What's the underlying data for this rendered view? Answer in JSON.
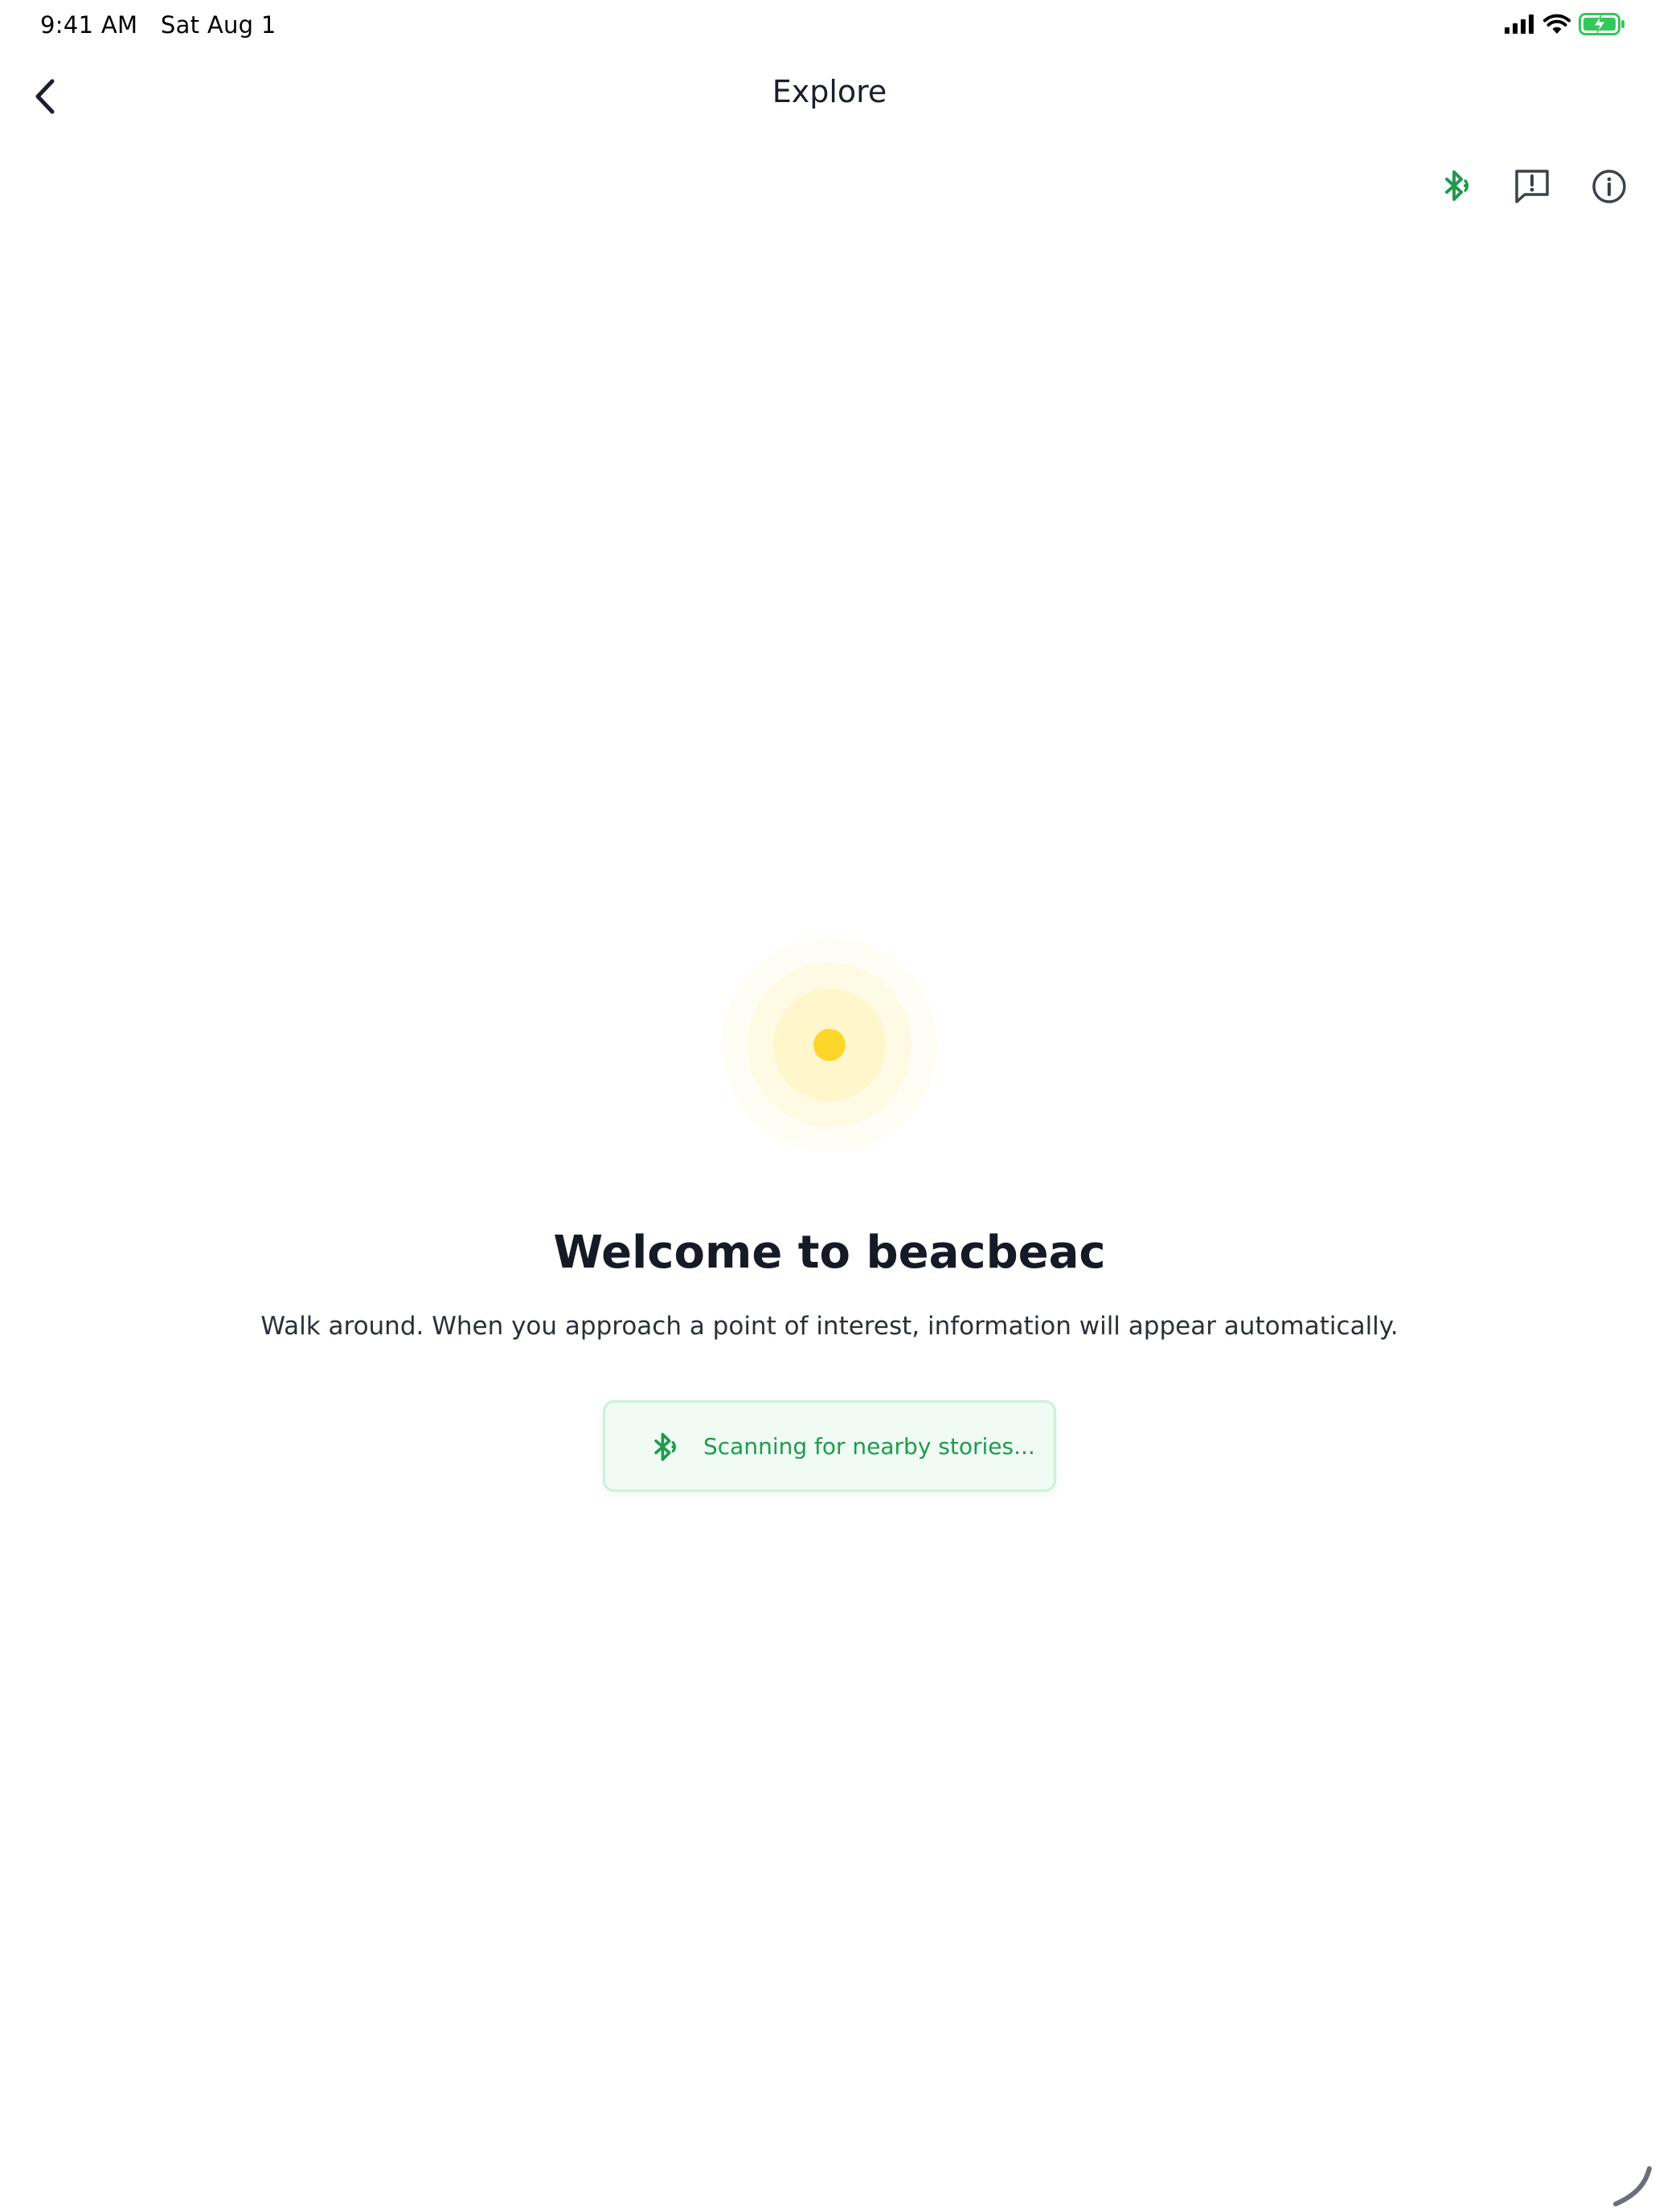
{
  "status_bar": {
    "time_date": "9:41 AM   Sat Aug 1",
    "icons": [
      "cellular-signal-icon",
      "wifi-icon",
      "battery-charging-icon"
    ]
  },
  "nav": {
    "back_icon": "chevron-left-icon",
    "title": "Explore"
  },
  "actions": [
    {
      "name": "bluetooth-scan-button",
      "icon": "bluetooth-signal-icon",
      "color": "#1f9a4f"
    },
    {
      "name": "report-button",
      "icon": "message-alert-icon",
      "color": "#3b414d"
    },
    {
      "name": "info-button",
      "icon": "info-circle-icon",
      "color": "#3b414d"
    }
  ],
  "beacon": {
    "icon": "beacon-pulse-icon",
    "accent_color": "#fcd72a"
  },
  "welcome": {
    "title": "Welcome to beacbeac",
    "subtitle": "Walk around. When you approach a point of interest, information will appear automatically."
  },
  "scan_status": {
    "icon": "bluetooth-signal-icon",
    "label": "Scanning for nearby stories...",
    "color": "#1f9a4f",
    "background": "#effbf3"
  },
  "colors": {
    "text_primary": "#161a26",
    "accent_green": "#1f9a4f",
    "accent_yellow": "#fcd72a",
    "battery_green": "#34c759"
  }
}
